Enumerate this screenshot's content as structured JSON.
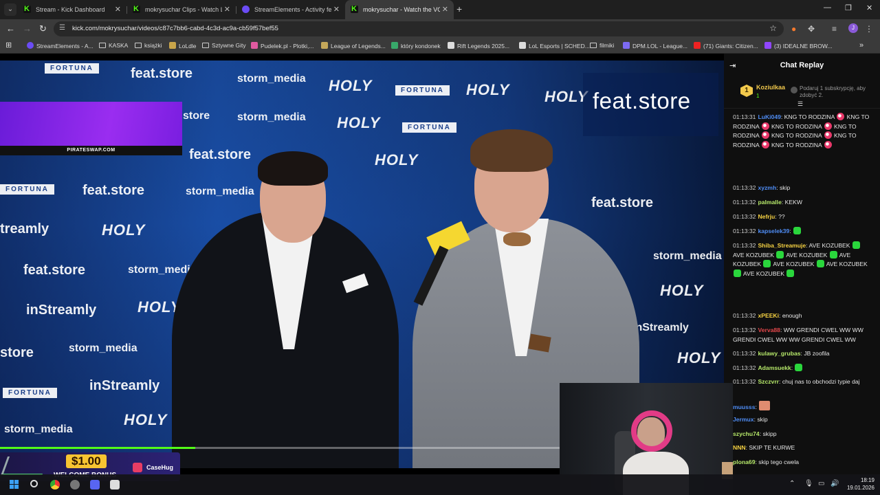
{
  "browser": {
    "tabs": [
      {
        "title": "Stream - Kick Dashboard",
        "icon": "kick-icon"
      },
      {
        "title": "mokrysuchar Clips - Watch Live",
        "icon": "kick-icon"
      },
      {
        "title": "StreamElements - Activity feed",
        "icon": "streamelements-icon"
      },
      {
        "title": "mokrysuchar - Watch the VOD",
        "icon": "kick-icon",
        "active": true
      }
    ],
    "url": "kick.com/mokrysuchar/videos/c87c7bb6-cabd-4c3d-ac9a-cb59f57bef55",
    "bookmarks": [
      {
        "label": "StreamElements - A...",
        "icon": "streamelements-icon"
      },
      {
        "label": "KASKA",
        "icon": "folder-icon"
      },
      {
        "label": "książki",
        "icon": "folder-icon"
      },
      {
        "label": "LoLdle",
        "icon": "loldle-icon"
      },
      {
        "label": "Sztywne Gity",
        "icon": "folder-icon"
      },
      {
        "label": "Pudelek.pl - Plotki,...",
        "icon": "pudelek-icon"
      },
      {
        "label": "League of Legends...",
        "icon": "league-icon"
      },
      {
        "label": "który kondonek",
        "icon": "link-icon"
      },
      {
        "label": "Rift Legends 2025...",
        "icon": "rift-icon"
      },
      {
        "label": "LoL Esports | SCHED...",
        "icon": "lolesports-icon"
      },
      {
        "label": "filmiki",
        "icon": "folder-icon"
      },
      {
        "label": "DPM.LOL - League...",
        "icon": "dpm-icon"
      },
      {
        "label": "(71) Giants: Citizen...",
        "icon": "youtube-icon"
      },
      {
        "label": "(3) IDEALNE BROW...",
        "icon": "twitch-icon"
      }
    ],
    "profile_initial": "J"
  },
  "stream": {
    "overlay_logo": "feat.store",
    "pirate_banner": "PIRATESWAP.COM",
    "bonus_amount": "$1.00",
    "bonus_text": "WELCOME BONUS",
    "bonus_brand": "CaseHug",
    "progress": 0.27,
    "wall_texts": {
      "fortuna": "FORTUNA",
      "featstore": "feat.store",
      "storm": "storm_media",
      "holy": "HOLY",
      "instreamly": "inStreamly",
      "store": "store",
      "streamly": "treamly"
    }
  },
  "chat": {
    "title": "Chat Replay",
    "gifter": {
      "rank": "1",
      "name": "Koziulkaa",
      "count": "1",
      "promo": "Podaruj 1 subskrypcję, aby zdobyć 2."
    },
    "messages": [
      {
        "ts": "01:13:31",
        "user": "LuKi049",
        "color": "#4f8df5",
        "text": "KNG TO RODZINA",
        "emote": "pink",
        "repeat": 7
      },
      {
        "ts": "01:13:32",
        "user": "xyzmh",
        "color": "#4f8df5",
        "text": "skip"
      },
      {
        "ts": "01:13:32",
        "user": "palmalle",
        "color": "#b6e86a",
        "text": "KEKW"
      },
      {
        "ts": "01:13:32",
        "user": "Nefrju",
        "color": "#f5d142",
        "text": "??"
      },
      {
        "ts": "01:13:32",
        "user": "kapselek39",
        "color": "#4f8df5",
        "text": "",
        "emote": "green",
        "repeat": 1
      },
      {
        "ts": "01:13:32",
        "user": "Shiba_Streamuje",
        "color": "#f5d142",
        "text": "AVE KOZUBEK",
        "emote": "green",
        "repeat": 7
      },
      {
        "ts": "01:13:32",
        "user": "xPEEKi",
        "color": "#f5d142",
        "text": "enough"
      },
      {
        "ts": "01:13:32",
        "user": "Verva88",
        "color": "#e2474b",
        "text": "WW GRENDI CWEL WW WW GRENDI CWEL WW WW GRENDI CWEL WW"
      },
      {
        "ts": "01:13:32",
        "user": "kulawy_grubas",
        "color": "#b6e86a",
        "text": "JB zoofila"
      },
      {
        "ts": "01:13:32",
        "user": "Adamsuekk",
        "color": "#b6e86a",
        "text": "",
        "emote": "green",
        "repeat": 1
      },
      {
        "ts": "01:13:32",
        "user": "Szczvrr",
        "color": "#b6e86a",
        "text": "chuj nas to obchodzi typie daj"
      },
      {
        "ts": "",
        "user": "muusss",
        "color": "#4f8df5",
        "text": "",
        "emote": "face",
        "repeat": 1
      },
      {
        "ts": "",
        "user": "Jermux",
        "color": "#4f8df5",
        "text": "skip"
      },
      {
        "ts": "",
        "user": "szychu74",
        "color": "#b6e86a",
        "text": "skipp"
      },
      {
        "ts": "",
        "user": "NNN",
        "color": "#f5d142",
        "text": "SKIP TE KURWE"
      },
      {
        "ts": "",
        "user": "plona69",
        "color": "#b6e86a",
        "text": "skip tego cwela"
      }
    ]
  },
  "taskbar": {
    "time": "18:19",
    "date": "19.01.2026"
  }
}
